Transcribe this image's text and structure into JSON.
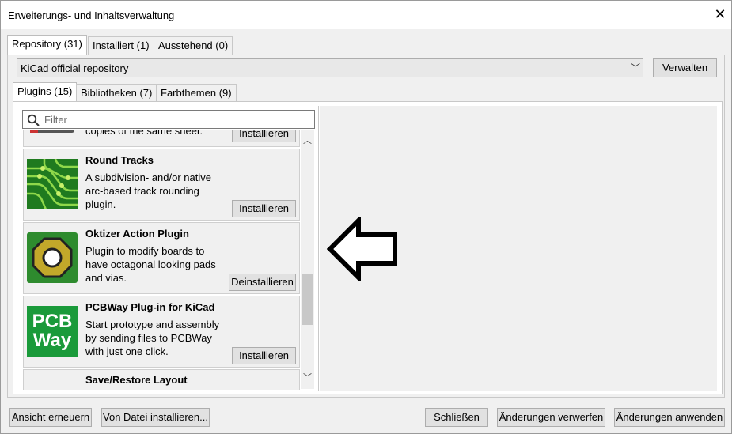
{
  "window": {
    "title": "Erweiterungs- und Inhaltsverwaltung"
  },
  "top_tabs": [
    {
      "label": "Repository (31)",
      "active": true
    },
    {
      "label": "Installiert (1)",
      "active": false
    },
    {
      "label": "Ausstehend (0)",
      "active": false
    }
  ],
  "repository": {
    "selected": "KiCad official repository",
    "manage_label": "Verwalten"
  },
  "content_tabs": [
    {
      "label": "Plugins (15)",
      "active": true
    },
    {
      "label": "Bibliotheken (7)",
      "active": false
    },
    {
      "label": "Farbthemen (9)",
      "active": false
    }
  ],
  "search": {
    "placeholder": "Filter"
  },
  "plugins": [
    {
      "title": "",
      "description": "copies of the same sheet.",
      "button": "Installieren"
    },
    {
      "title": "Round Tracks",
      "description": "A subdivision- and/or native arc-based track rounding plugin.",
      "button": "Installieren",
      "icon": "pcb-traces-icon"
    },
    {
      "title": "Oktizer Action Plugin",
      "description": "Plugin to modify boards to have octagonal looking pads and vias.",
      "button": "Deinstallieren",
      "icon": "octagon-pad-icon"
    },
    {
      "title": "PCBWay Plug-in for KiCad",
      "description": "Start prototype and assembly by sending files to PCBWay with just one click.",
      "button": "Installieren",
      "icon": "pcbway-logo",
      "logo_text": "PCB Way"
    },
    {
      "title": "Save/Restore Layout",
      "description": "",
      "button": ""
    }
  ],
  "footer": {
    "refresh": "Ansicht erneuern",
    "install_from_file": "Von Datei installieren...",
    "close": "Schließen",
    "discard": "Änderungen verwerfen",
    "apply": "Änderungen anwenden"
  },
  "colors": {
    "icon_green": "#2e8b2e",
    "pcbway_green": "#1a9a3a",
    "pad_gold": "#c2a82a"
  }
}
